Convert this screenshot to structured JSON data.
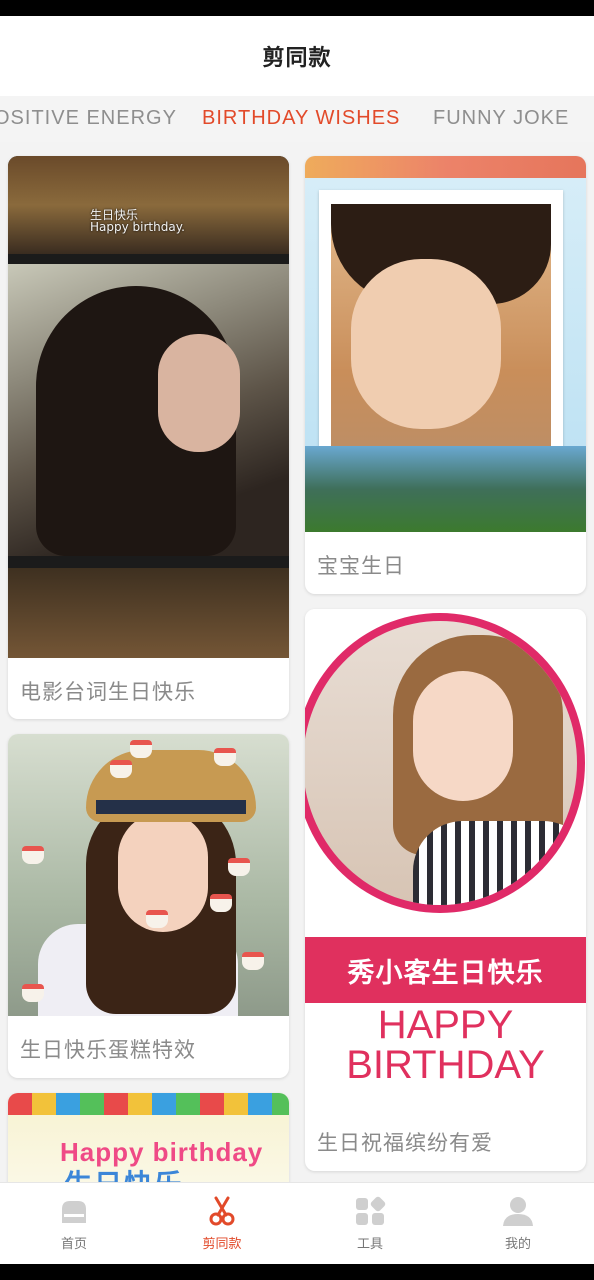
{
  "header": {
    "title": "剪同款"
  },
  "tabs": [
    {
      "label": "OSITIVE ENERGY",
      "active": false
    },
    {
      "label": "BIRTHDAY WISHES",
      "active": true
    },
    {
      "label": "FUNNY JOKE",
      "active": false
    }
  ],
  "cards": [
    {
      "title": "电影台词生日快乐",
      "subtitle_cn": "生日快乐",
      "subtitle_en": "Happy birthday."
    },
    {
      "title": "宝宝生日"
    },
    {
      "title": "生日快乐蛋糕特效"
    },
    {
      "title": "生日祝福缤纷有爱",
      "banner_text": "秀小客生日快乐",
      "overlay_text": "HAPPY BIRTHDAY"
    },
    {
      "title": "",
      "party_text": "Happy birthday",
      "party_cn": "生日快乐"
    }
  ],
  "bottom_nav": [
    {
      "label": "首页",
      "icon": "home-icon",
      "active": false
    },
    {
      "label": "剪同款",
      "icon": "scissors-icon",
      "active": true
    },
    {
      "label": "工具",
      "icon": "tools-icon",
      "active": false
    },
    {
      "label": "我的",
      "icon": "profile-icon",
      "active": false
    }
  ],
  "colors": {
    "accent": "#e24a2a",
    "card_bg": "#ffffff",
    "page_bg": "#f3f3f3",
    "inactive": "#8e8e8e"
  }
}
